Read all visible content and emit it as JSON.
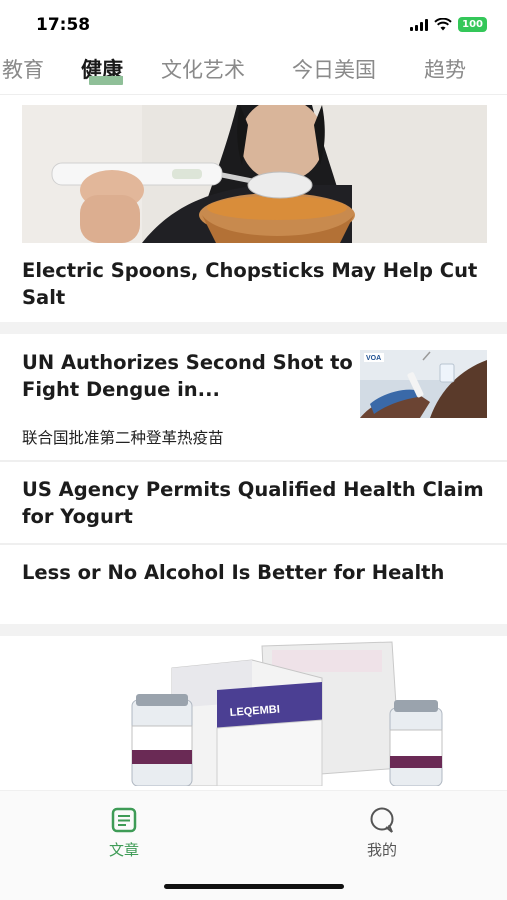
{
  "status_bar": {
    "time": "17:58",
    "battery": "100"
  },
  "tabs": [
    {
      "label": "教育",
      "active": false
    },
    {
      "label": "健康",
      "active": true
    },
    {
      "label": "文化艺术",
      "active": false
    },
    {
      "label": "今日美国",
      "active": false
    },
    {
      "label": "趋势",
      "active": false
    }
  ],
  "articles": [
    {
      "title": "Electric Spoons, Chopsticks May Help Cut Salt"
    },
    {
      "title": "UN Authorizes Second Shot to Fight Dengue in...",
      "subtitle": "联合国批准第二种登革热疫苗",
      "thumb_text": "VOA"
    },
    {
      "title": "US Agency Permits Qualified Health Claim for Yogurt"
    },
    {
      "title": "Less or No Alcohol Is Better for Health"
    }
  ],
  "bottom_image": {
    "brand": "LEQEMBI"
  },
  "bottom_nav": [
    {
      "label": "文章",
      "icon": "article-icon",
      "active": true,
      "color": "#3e9b56"
    },
    {
      "label": "我的",
      "icon": "profile-chat-icon",
      "active": false,
      "color": "#555555"
    }
  ]
}
